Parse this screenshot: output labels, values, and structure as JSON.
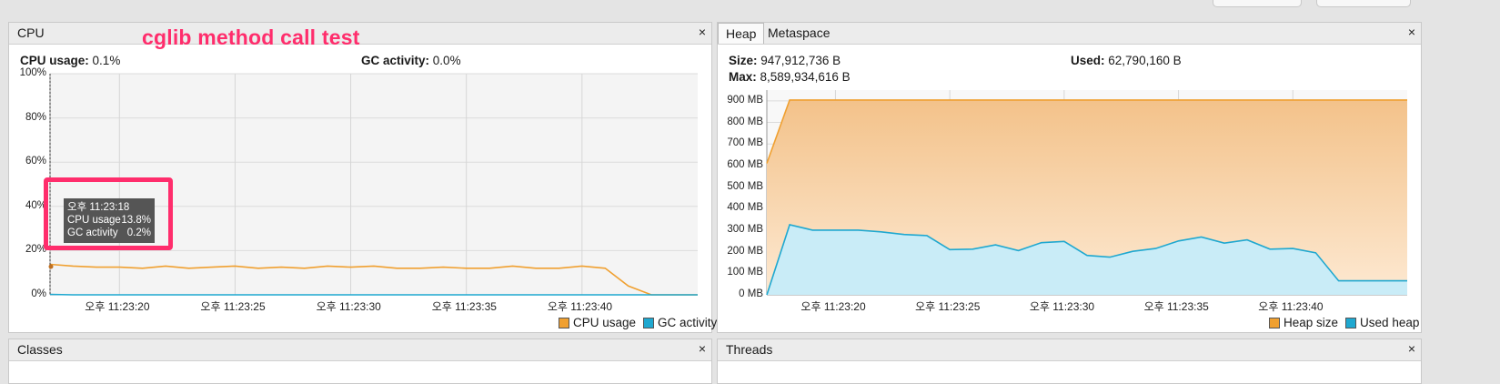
{
  "annotation": {
    "text": "cglib method call test"
  },
  "cpu_panel": {
    "title": "CPU",
    "cpu_usage_label": "CPU usage:",
    "cpu_usage_value": "0.1%",
    "gc_activity_label": "GC activity:",
    "gc_activity_value": "0.0%",
    "close_glyph": "×",
    "legend": {
      "cpu": "CPU usage",
      "gc": "GC activity"
    },
    "tooltip": {
      "time": "오후 11:23:18",
      "cpu_label": "CPU usage",
      "cpu_value": "13.8%",
      "gc_label": "GC activity",
      "gc_value": "0.2%"
    }
  },
  "heap_panel": {
    "tabs": [
      "Heap",
      "Metaspace"
    ],
    "active_tab": "Heap",
    "size_label": "Size:",
    "size_value": "947,912,736 B",
    "used_label": "Used:",
    "used_value": "62,790,160 B",
    "max_label": "Max:",
    "max_value": "8,589,934,616 B",
    "close_glyph": "×",
    "legend": {
      "heap": "Heap size",
      "used": "Used heap"
    }
  },
  "classes_panel": {
    "title": "Classes",
    "close_glyph": "×"
  },
  "threads_panel": {
    "title": "Threads",
    "close_glyph": "×"
  },
  "colors": {
    "cpu": "#f0a030",
    "gc": "#1fa8d0",
    "heap_fill": "#f5c48a",
    "used_fill": "#c9ecf7",
    "annotation": "#ff2d6c"
  },
  "chart_data": [
    {
      "type": "line",
      "title": "CPU",
      "ylim": [
        0,
        100
      ],
      "yticks": [
        "0%",
        "20%",
        "40%",
        "60%",
        "80%",
        "100%"
      ],
      "xticks": [
        "오후 11:23:20",
        "오후 11:23:25",
        "오후 11:23:30",
        "오후 11:23:35",
        "오후 11:23:40"
      ],
      "x_seconds": [
        17,
        18,
        19,
        20,
        21,
        22,
        23,
        24,
        25,
        26,
        27,
        28,
        29,
        30,
        31,
        32,
        33,
        34,
        35,
        36,
        37,
        38,
        39,
        40,
        41,
        42,
        43,
        44,
        45
      ],
      "series": [
        {
          "name": "CPU usage",
          "values": [
            13.8,
            13,
            12.5,
            12.5,
            12,
            13,
            12,
            12.5,
            13,
            12,
            12.5,
            12,
            13,
            12.5,
            13,
            12,
            12,
            12.5,
            12,
            12,
            13,
            12,
            12,
            13,
            12,
            4,
            0,
            0,
            0
          ]
        },
        {
          "name": "GC activity",
          "values": [
            0.2,
            0,
            0,
            0,
            0,
            0,
            0,
            0,
            0,
            0,
            0,
            0,
            0,
            0,
            0,
            0,
            0,
            0,
            0,
            0,
            0,
            0,
            0,
            0,
            0,
            0,
            0,
            0,
            0
          ]
        }
      ],
      "grid": true,
      "legend": "bottom-right"
    },
    {
      "type": "area",
      "title": "Heap",
      "ylim": [
        0,
        950
      ],
      "yticks": [
        "0 MB",
        "100 MB",
        "200 MB",
        "300 MB",
        "400 MB",
        "500 MB",
        "600 MB",
        "700 MB",
        "800 MB",
        "900 MB"
      ],
      "xticks": [
        "오후 11:23:20",
        "오후 11:23:25",
        "오후 11:23:30",
        "오후 11:23:35",
        "오후 11:23:40"
      ],
      "x_seconds": [
        17,
        18,
        19,
        20,
        21,
        22,
        23,
        24,
        25,
        26,
        27,
        28,
        29,
        30,
        31,
        32,
        33,
        34,
        35,
        36,
        37,
        38,
        39,
        40,
        41,
        42,
        43,
        44,
        45
      ],
      "series": [
        {
          "name": "Heap size",
          "values": [
            610,
            904,
            904,
            904,
            904,
            904,
            904,
            904,
            904,
            904,
            904,
            904,
            904,
            904,
            904,
            904,
            904,
            904,
            904,
            904,
            904,
            904,
            904,
            904,
            904,
            904,
            904,
            904,
            904
          ]
        },
        {
          "name": "Used heap",
          "values": [
            0,
            325,
            300,
            300,
            300,
            292,
            280,
            275,
            210,
            212,
            232,
            205,
            242,
            248,
            183,
            175,
            202,
            215,
            250,
            268,
            240,
            255,
            212,
            215,
            195,
            65,
            65,
            65,
            65
          ]
        }
      ],
      "grid": true,
      "legend": "bottom-right"
    }
  ]
}
